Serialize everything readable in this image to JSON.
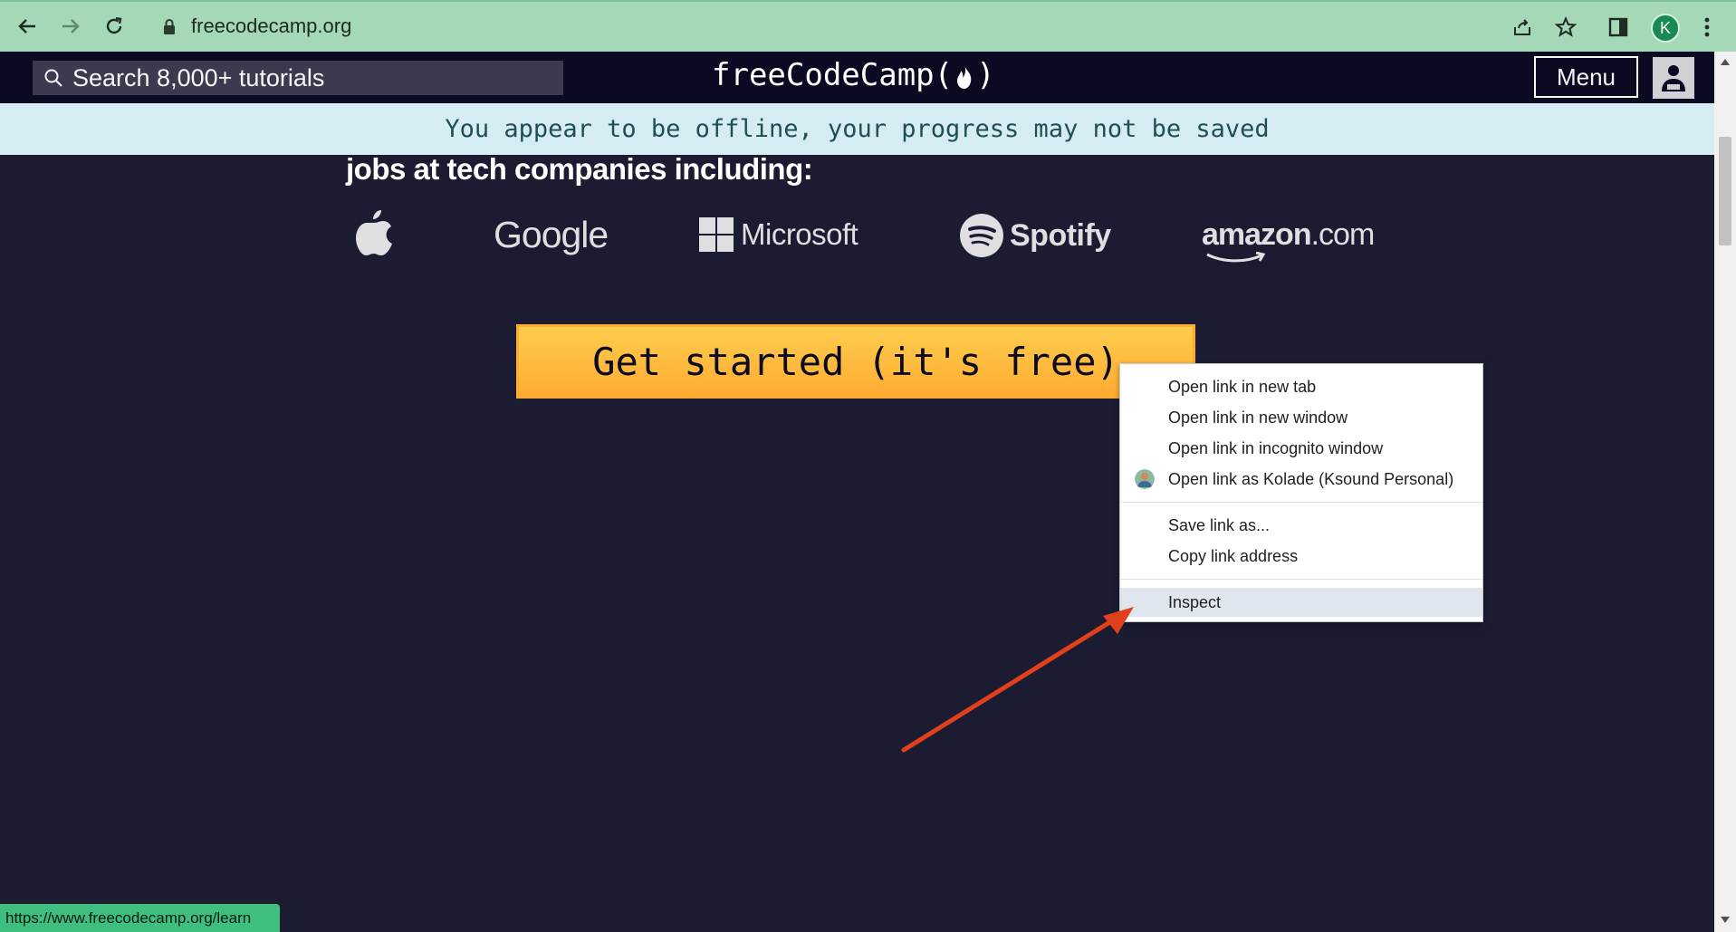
{
  "browser": {
    "url": "freecodecamp.org",
    "avatar_letter": "K",
    "status_url": "https://www.freecodecamp.org/learn"
  },
  "site_nav": {
    "search_placeholder": "Search 8,000+ tutorials",
    "brand": "freeCodeCamp",
    "brand_open": "(",
    "brand_close": ")",
    "menu_label": "Menu"
  },
  "offline_banner": "You appear to be offline, your progress may not be saved",
  "content": {
    "jobs_heading": "jobs at tech companies including:",
    "companies": {
      "google": "Google",
      "microsoft": "Microsoft",
      "spotify": "Spotify",
      "amazon": "amazon",
      "amazon_suffix": ".com"
    },
    "cta_label": "Get started (it's free)"
  },
  "context_menu": {
    "items": [
      {
        "label": "Open link in new tab"
      },
      {
        "label": "Open link in new window"
      },
      {
        "label": "Open link in incognito window"
      },
      {
        "label": "Open link as Kolade (Ksound Personal)"
      },
      {
        "label": "Save link as..."
      },
      {
        "label": "Copy link address"
      },
      {
        "label": "Inspect"
      }
    ],
    "highlighted": "Inspect"
  },
  "colors": {
    "chrome_bg": "#a4d8b7",
    "site_bg": "#1b1b32",
    "nav_bg": "#0a0a23",
    "cta_bg": "#feac32",
    "arrow": "#e2401c",
    "status_bg": "#3fbf7f"
  }
}
